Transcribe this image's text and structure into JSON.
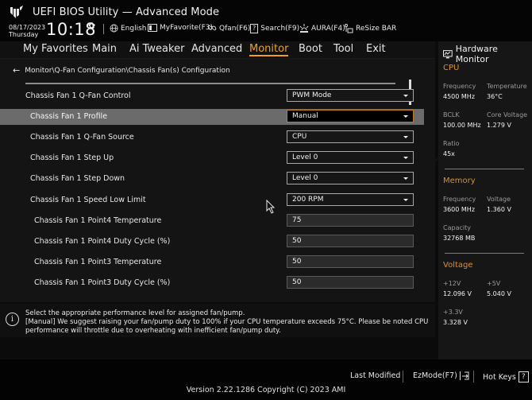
{
  "header": {
    "title": "UEFI BIOS Utility — Advanced Mode",
    "date": "08/17/2023",
    "weekday": "Thursday",
    "time": "10:18",
    "buttons": [
      {
        "icon": "globe-icon",
        "label": "English"
      },
      {
        "icon": "favorite-icon",
        "label": "MyFavorite(F3)"
      },
      {
        "icon": "fan-icon",
        "label": "Qfan(F6)"
      },
      {
        "icon": "question-icon",
        "label": "Search(F9)"
      },
      {
        "icon": "aura-icon",
        "label": "AURA(F4)"
      },
      {
        "icon": "resize-bar-icon",
        "label": "ReSize BAR"
      }
    ]
  },
  "nav": {
    "tabs": [
      {
        "label": "My Favorites",
        "active": false
      },
      {
        "label": "Main",
        "active": false
      },
      {
        "label": "Ai Tweaker",
        "active": false
      },
      {
        "label": "Advanced",
        "active": false
      },
      {
        "label": "Monitor",
        "active": true
      },
      {
        "label": "Boot",
        "active": false
      },
      {
        "label": "Tool",
        "active": false
      },
      {
        "label": "Exit",
        "active": false
      }
    ]
  },
  "main": {
    "breadcrumb": "Monitor\\Q-Fan Configuration\\Chassis Fan(s) Configuration",
    "settings": [
      {
        "label": "Chassis Fan 1 Q-Fan Control",
        "type": "select",
        "value": "PWM Mode"
      },
      {
        "label": "Chassis Fan 1 Profile",
        "type": "select",
        "value": "Manual",
        "selected": true
      },
      {
        "label": "Chassis Fan 1 Q-Fan Source",
        "type": "select",
        "value": "CPU"
      },
      {
        "label": "Chassis Fan 1 Step Up",
        "type": "select",
        "value": "Level 0"
      },
      {
        "label": "Chassis Fan 1 Step Down",
        "type": "select",
        "value": "Level 0"
      },
      {
        "label": "Chassis Fan 1 Speed Low Limit",
        "type": "select",
        "value": "200 RPM"
      },
      {
        "label": "Chassis Fan 1 Point4 Temperature",
        "type": "input",
        "value": "75"
      },
      {
        "label": "Chassis Fan 1 Point4 Duty Cycle (%)",
        "type": "input",
        "value": "50"
      },
      {
        "label": "Chassis Fan 1 Point3 Temperature",
        "type": "input",
        "value": "50"
      },
      {
        "label": "Chassis Fan 1 Point3 Duty Cycle (%)",
        "type": "input",
        "value": "50"
      }
    ]
  },
  "info": {
    "lines": [
      "Select the appropriate performance level for assigned fan/pump.",
      "[Manual] We suggest raising your fan/pump duty to 100% if your CPU temperature exceeds 75°C. Please be noted CPU performance will throttle due to overheating with inefficient fan/pump duty."
    ]
  },
  "hardware_monitor": {
    "title": "Hardware Monitor",
    "cpu": {
      "heading": "CPU",
      "frequency_label": "Frequency",
      "frequency": "4500 MHz",
      "temperature_label": "Temperature",
      "temperature": "36°C",
      "bclk_label": "BCLK",
      "bclk": "100.00 MHz",
      "core_voltage_label": "Core Voltage",
      "core_voltage": "1.279 V",
      "ratio_label": "Ratio",
      "ratio": "45x"
    },
    "memory": {
      "heading": "Memory",
      "frequency_label": "Frequency",
      "frequency": "3600 MHz",
      "voltage_label": "Voltage",
      "voltage": "1.360 V",
      "capacity_label": "Capacity",
      "capacity": "32768 MB"
    },
    "voltage": {
      "heading": "Voltage",
      "v12_label": "+12V",
      "v12": "12.096 V",
      "v5_label": "+5V",
      "v5": "5.040 V",
      "v33_label": "+3.3V",
      "v33": "3.328 V"
    }
  },
  "footer": {
    "last_modified": "Last Modified",
    "ezmode": "EzMode(F7)",
    "hotkeys": "Hot Keys",
    "hotkeys_glyph": "?",
    "version": "Version 2.22.1286 Copyright (C) 2023 AMI"
  },
  "colors": {
    "accent": "#f0a020",
    "section_heading": "#e2901c",
    "selected_row": "#6b6b6b"
  }
}
